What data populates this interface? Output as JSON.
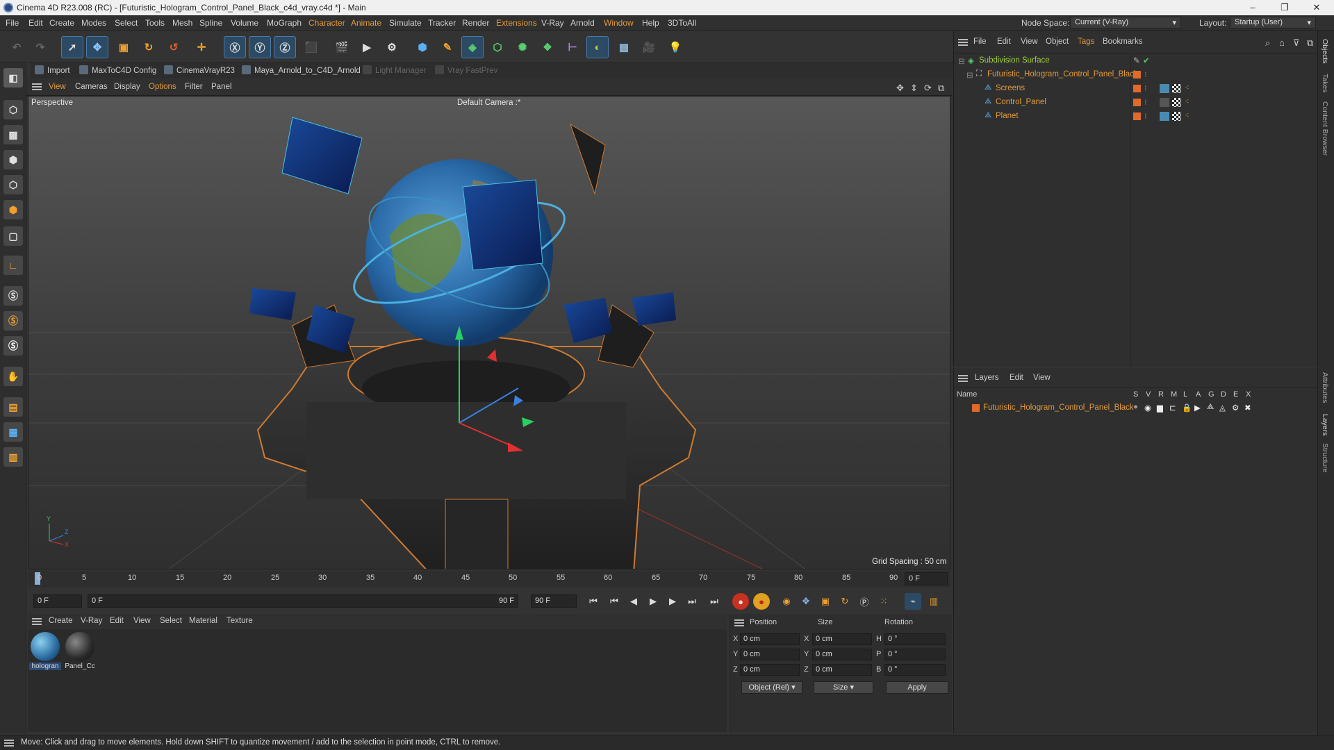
{
  "window": {
    "title": "Cinema 4D R23.008 (RC) - [Futuristic_Hologram_Control_Panel_Black_c4d_vray.c4d *] - Main",
    "min": "–",
    "max": "❐",
    "close": "✕"
  },
  "menus": [
    "File",
    "Edit",
    "Create",
    "Modes",
    "Select",
    "Tools",
    "Mesh",
    "Spline",
    "Volume",
    "MoGraph",
    "Character",
    "Animate",
    "Simulate",
    "Tracker",
    "Render",
    "Extensions",
    "V-Ray",
    "Arnold",
    "Window",
    "Help",
    "3DToAll"
  ],
  "node_space": {
    "label": "Node Space:",
    "value": "Current (V-Ray)"
  },
  "layout": {
    "label": "Layout:",
    "value": "Startup (User)"
  },
  "plugins": [
    {
      "label": "Import",
      "enabled": true
    },
    {
      "label": "MaxToC4D Config",
      "enabled": true
    },
    {
      "label": "CinemaVrayR23",
      "enabled": true
    },
    {
      "label": "Maya_Arnold_to_C4D_Arnold",
      "enabled": true
    },
    {
      "label": "Light Manager",
      "enabled": false
    },
    {
      "label": "Vray FastPrev",
      "enabled": false
    }
  ],
  "viewport": {
    "menus": [
      "View",
      "Cameras",
      "Display",
      "Options",
      "Filter",
      "Panel"
    ],
    "projection": "Perspective",
    "camera": "Default Camera :*",
    "grid_spacing": "Grid Spacing : 50 cm",
    "axis_y": "Y",
    "axis_z": "Z",
    "axis_x": "X"
  },
  "timeline": {
    "ticks": [
      "0",
      "5",
      "10",
      "15",
      "20",
      "25",
      "30",
      "35",
      "40",
      "45",
      "50",
      "55",
      "60",
      "65",
      "70",
      "75",
      "80",
      "85",
      "90"
    ],
    "current_frame": "0 F"
  },
  "transport": {
    "start": "0 F",
    "range_start": "0 F",
    "range_end": "90 F",
    "end": "90 F"
  },
  "materials": {
    "menus": [
      "Create",
      "V-Ray",
      "Edit",
      "View",
      "Select",
      "Material",
      "Texture"
    ],
    "items": [
      {
        "name": "hologran",
        "color": "#3a8ab8"
      },
      {
        "name": "Panel_Cc",
        "color": "#2a2a2a"
      }
    ]
  },
  "coordinates": {
    "headers": [
      "Position",
      "Size",
      "Rotation"
    ],
    "rows": [
      {
        "axis": "X",
        "pos": "0 cm",
        "saxis": "X",
        "size": "0 cm",
        "raxis": "H",
        "rot": "0 °"
      },
      {
        "axis": "Y",
        "pos": "0 cm",
        "saxis": "Y",
        "size": "0 cm",
        "raxis": "P",
        "rot": "0 °"
      },
      {
        "axis": "Z",
        "pos": "0 cm",
        "saxis": "Z",
        "size": "0 cm",
        "raxis": "B",
        "rot": "0 °"
      }
    ],
    "mode": "Object (Rel)",
    "size_mode": "Size",
    "apply": "Apply"
  },
  "objects": {
    "menus": [
      "File",
      "Edit",
      "View",
      "Object",
      "Tags",
      "Bookmarks"
    ],
    "items": [
      {
        "name": "Subdivision Surface",
        "color": "#9fd13a"
      },
      {
        "name": "Futuristic_Hologram_Control_Panel_Black",
        "color": "#e39a3a"
      },
      {
        "name": "Screens",
        "color": "#e39a3a"
      },
      {
        "name": "Control_Panel",
        "color": "#e39a3a"
      },
      {
        "name": "Planet",
        "color": "#e39a3a"
      }
    ]
  },
  "layers": {
    "menus": [
      "Layers",
      "Edit",
      "View"
    ],
    "name_header": "Name",
    "flags": [
      "S",
      "V",
      "R",
      "M",
      "L",
      "A",
      "G",
      "D",
      "E",
      "X"
    ],
    "items": [
      {
        "name": "Futuristic_Hologram_Control_Panel_Black"
      }
    ]
  },
  "sidetabs": [
    "Objects",
    "Takes",
    "Content Browser",
    "Attributes",
    "Layers",
    "Structure"
  ],
  "status": "Move: Click and drag to move elements. Hold down SHIFT to quantize movement / add to the selection in point mode, CTRL to remove.",
  "colors": {
    "accent": "#e39a3a",
    "selected": "#9fd13a",
    "hud_blue": "#1a4a8a"
  }
}
